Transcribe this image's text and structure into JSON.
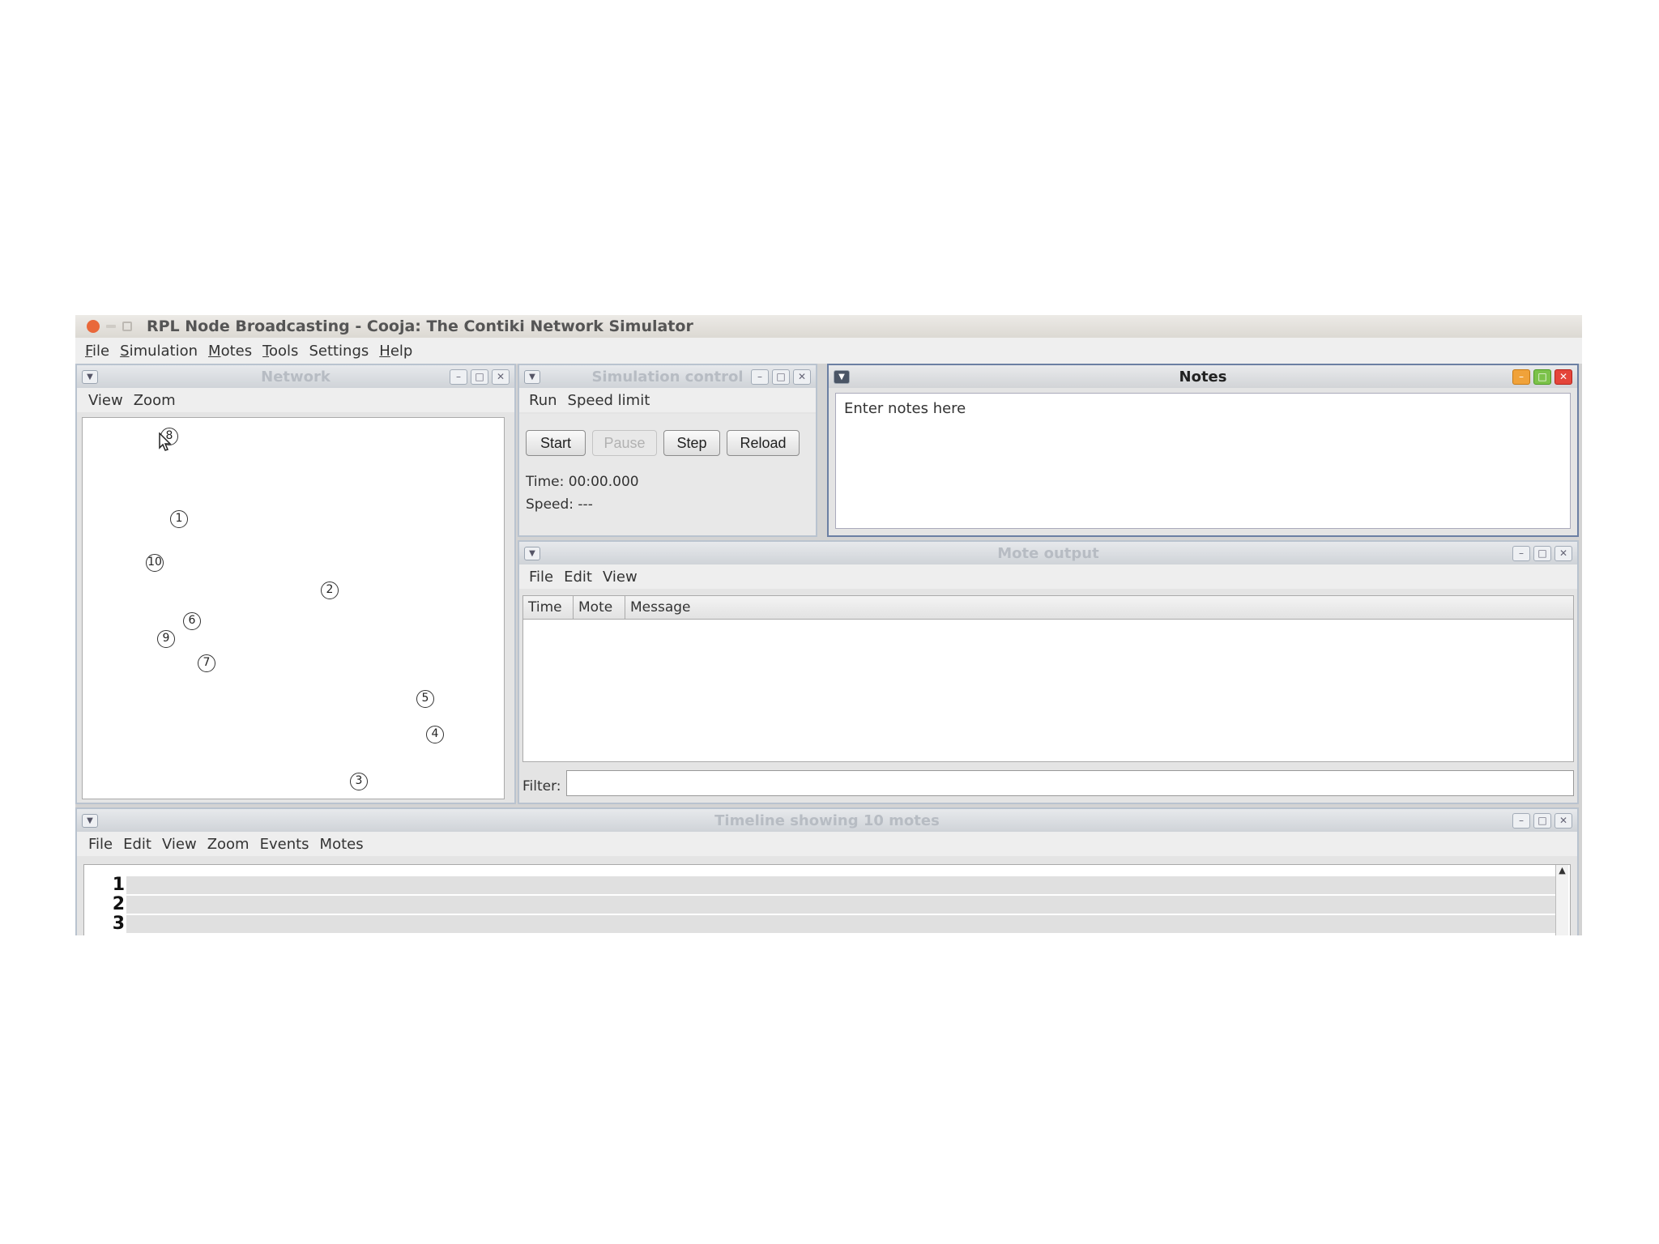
{
  "window": {
    "title": "RPL Node Broadcasting - Cooja: The Contiki Network Simulator"
  },
  "menubar": {
    "items": [
      {
        "label_first": "F",
        "label_rest": "ile"
      },
      {
        "label_first": "S",
        "label_rest": "imulation"
      },
      {
        "label_first": "M",
        "label_rest": "otes"
      },
      {
        "label_first": "T",
        "label_rest": "ools"
      },
      {
        "label_first": "",
        "label_rest": "Settings"
      },
      {
        "label_first": "H",
        "label_rest": "elp"
      }
    ]
  },
  "network": {
    "title": "Network",
    "menu": [
      "View",
      "Zoom"
    ],
    "motes": [
      "8",
      "1",
      "10",
      "2",
      "6",
      "9",
      "7",
      "5",
      "4",
      "3"
    ]
  },
  "simulation_control": {
    "title": "Simulation control",
    "menu": [
      "Run",
      "Speed limit"
    ],
    "buttons": {
      "start": "Start",
      "pause": "Pause",
      "step": "Step",
      "reload": "Reload"
    },
    "time": "Time: 00:00.000",
    "speed": "Speed: ---"
  },
  "notes": {
    "title": "Notes",
    "placeholder": "Enter notes here"
  },
  "mote_output": {
    "title": "Mote output",
    "menu": [
      "File",
      "Edit",
      "View"
    ],
    "columns": [
      "Time",
      "Mote",
      "Message"
    ],
    "filter_label": "Filter:"
  },
  "timeline": {
    "title": "Timeline showing 10 motes",
    "menu": [
      "File",
      "Edit",
      "View",
      "Zoom",
      "Events",
      "Motes"
    ],
    "rows": [
      "1",
      "2",
      "3"
    ]
  },
  "colors": {
    "active_frame_border": "#6b7fa3",
    "inactive_title_text": "#b7bcc3",
    "close_button": "#e4453a",
    "maximize_button": "#7cc24a",
    "minimize_button": "#f0a23a"
  }
}
